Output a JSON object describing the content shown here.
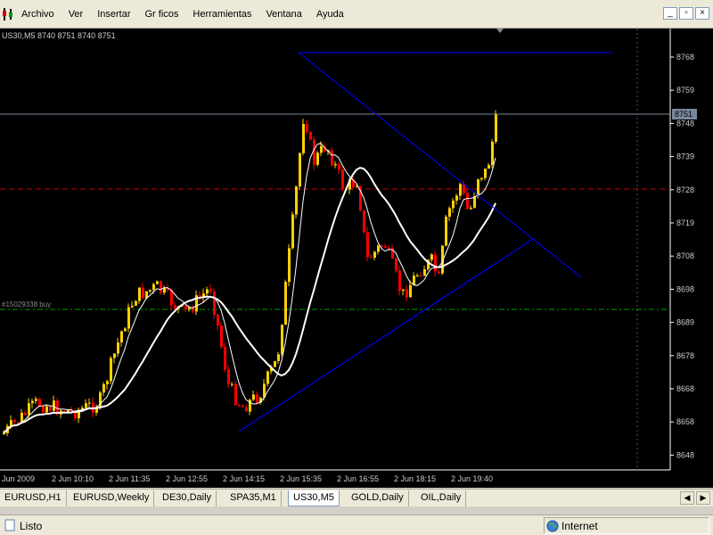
{
  "menu": {
    "items": [
      "Archivo",
      "Ver",
      "Insertar",
      "Gr ficos",
      "Herramientas",
      "Ventana",
      "Ayuda"
    ]
  },
  "chart": {
    "header": "US30,M5  8740 8751 8740 8751",
    "current_price": "8751",
    "order_label": "#15029338 buy",
    "price_labels": [
      "8768",
      "8759",
      "8748",
      "8739",
      "8728",
      "8719",
      "8708",
      "8698",
      "8689",
      "8678",
      "8668",
      "8658",
      "8648"
    ],
    "time_labels": [
      "Jun 2009",
      "2 Jun 10:10",
      "2 Jun 11:35",
      "2 Jun 12:55",
      "2 Jun 14:15",
      "2 Jun 15:35",
      "2 Jun 16:55",
      "2 Jun 18:15",
      "2 Jun 19:40"
    ],
    "colors": {
      "bull": "#ffd200",
      "bear": "#ff0000",
      "ma_slow": "#ffffff",
      "ma_fast": "#ffffff",
      "trendline": "#0000ff",
      "resistance": "#ff0000",
      "order": "#00a000",
      "current": "#778899"
    }
  },
  "tabs": [
    "EURUSD,H1",
    "EURUSD,Weekly",
    "DE30,Daily",
    "SPA35,M1",
    "US30,M5",
    "GOLD,Daily",
    "OIL,Daily"
  ],
  "active_tab": "US30,M5",
  "status": {
    "text": "Listo",
    "zone": "Internet"
  }
}
